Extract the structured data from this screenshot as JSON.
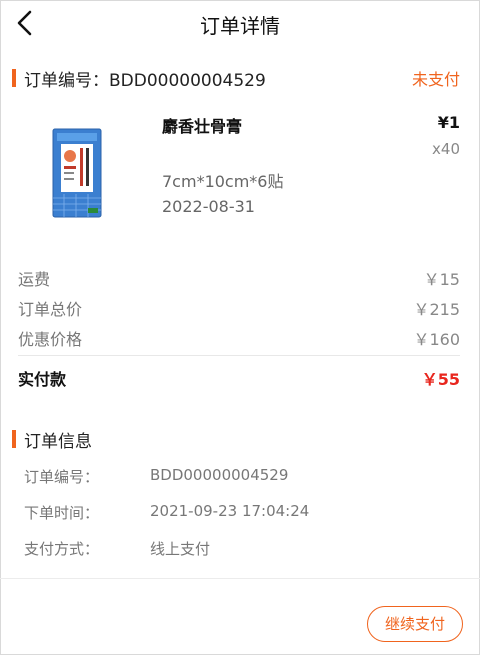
{
  "header": {
    "title": "订单详情"
  },
  "order": {
    "number_label": "订单编号：BDD00000004529",
    "status": "未支付"
  },
  "product": {
    "name": "麝香壮骨膏",
    "price": "¥1",
    "quantity": "x40",
    "spec": "7cm*10cm*6贴",
    "date": "2022-08-31"
  },
  "costs": {
    "shipping_label": "运费",
    "shipping_value": "￥15",
    "total_label": "订单总价",
    "total_value": "￥215",
    "discount_label": "优惠价格",
    "discount_value": "￥160",
    "paid_label": "实付款",
    "paid_value": "￥55"
  },
  "info": {
    "title": "订单信息",
    "rows": [
      {
        "key": "订单编号：",
        "value": "BDD00000004529"
      },
      {
        "key": "下单时间：",
        "value": "2021-09-23 17:04:24"
      },
      {
        "key": "支付方式：",
        "value": "线上支付"
      }
    ]
  },
  "actions": {
    "continue_pay": "继续支付"
  },
  "colors": {
    "accent": "#f0641e",
    "price_red": "#e8261e"
  }
}
